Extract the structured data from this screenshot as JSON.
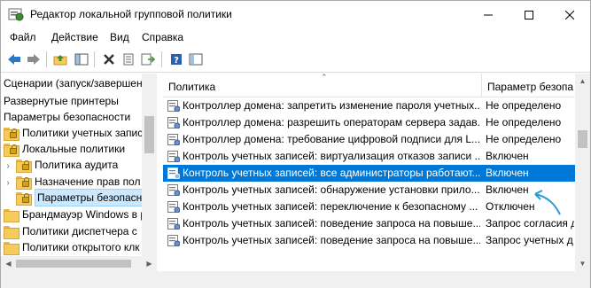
{
  "window": {
    "title": "Редактор локальной групповой политики"
  },
  "menu": [
    "Файл",
    "Действие",
    "Вид",
    "Справка"
  ],
  "toolbar": {
    "icons": [
      "back-arrow-icon",
      "forward-arrow-icon",
      "up-folder-icon",
      "show-hide-tree-icon",
      "delete-icon",
      "properties-icon",
      "export-list-icon",
      "help-icon",
      "extended-view-icon"
    ]
  },
  "tree": {
    "items": [
      {
        "label": "Сценарии (запуск/завершен",
        "indent": 0,
        "icon": "none"
      },
      {
        "label": "Развернутые принтеры",
        "indent": 0,
        "icon": "none"
      },
      {
        "label": "Параметры безопасности",
        "indent": 0,
        "icon": "none"
      },
      {
        "label": "Политики учетных запис",
        "indent": 1,
        "icon": "folder-lock-icon",
        "caret": ">"
      },
      {
        "label": "Локальные политики",
        "indent": 1,
        "icon": "folder-lock-icon",
        "caret": "v"
      },
      {
        "label": "Политика аудита",
        "indent": 2,
        "icon": "folder-lock-icon",
        "caret": ">"
      },
      {
        "label": "Назначение прав пол",
        "indent": 2,
        "icon": "folder-lock-icon",
        "caret": ">"
      },
      {
        "label": "Параметры безопасн",
        "indent": 2,
        "icon": "folder-lock-icon",
        "caret": "",
        "selected": true
      },
      {
        "label": "Брандмауэр Windows в р",
        "indent": 1,
        "icon": "folder-icon",
        "caret": ">"
      },
      {
        "label": "Политики диспетчера с",
        "indent": 1,
        "icon": "folder-icon",
        "caret": ""
      },
      {
        "label": "Политики открытого клк",
        "indent": 1,
        "icon": "folder-icon",
        "caret": ">"
      }
    ]
  },
  "list": {
    "columns": [
      "Политика",
      "Параметр безопа"
    ],
    "rows": [
      {
        "policy": "Контроллер домена: запретить изменение пароля учетных...",
        "setting": "Не определено"
      },
      {
        "policy": "Контроллер домена: разрешить операторам сервера задав...",
        "setting": "Не определено"
      },
      {
        "policy": "Контроллер домена: требование цифровой подписи для L...",
        "setting": "Не определено"
      },
      {
        "policy": "Контроль учетных записей: виртуализация отказов записи ...",
        "setting": "Включен"
      },
      {
        "policy": "Контроль учетных записей: все администраторы работают...",
        "setting": "Включен",
        "selected": true
      },
      {
        "policy": "Контроль учетных записей: обнаружение установки прило...",
        "setting": "Включен"
      },
      {
        "policy": "Контроль учетных записей: переключение к безопасному ...",
        "setting": "Отключен"
      },
      {
        "policy": "Контроль учетных записей: поведение запроса на повыше...",
        "setting": "Запрос согласия д"
      },
      {
        "policy": "Контроль учетных записей: поведение запроса на повыше...",
        "setting": "Запрос учетных д"
      }
    ]
  },
  "colors": {
    "selection": "#0078d7",
    "tree_selection": "#cce8ff",
    "annotation_arrow": "#2a9bd6"
  }
}
